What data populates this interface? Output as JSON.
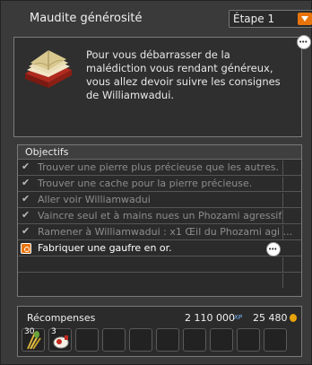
{
  "window": {
    "title": "Maudite générosité",
    "step": "Étape 1"
  },
  "description": {
    "text": "Pour vous débarrasser de la malédiction vous rendant généreux, vous allez devoir suivre les consignes de Williamwadui.",
    "icon": "book-icon"
  },
  "objectives": {
    "header": "Objectifs",
    "items": [
      {
        "label": "Trouver une pierre plus précieuse que les autres.",
        "done": true
      },
      {
        "label": "Trouver une cache pour la pierre précieuse.",
        "done": true
      },
      {
        "label": "Aller voir Williamwadui",
        "done": true
      },
      {
        "label": "Vaincre seul et à mains nues un Phozami agressif.",
        "done": true
      },
      {
        "label": "Ramener à Williamwadui : x1 Œil du Phozami agi ...",
        "done": true
      },
      {
        "label": "Fabriquer une gaufre en or.",
        "done": false
      }
    ]
  },
  "rewards": {
    "label": "Récompenses",
    "xp": "2 110 000",
    "xp_tag": "XP",
    "kamas": "25 480",
    "items": [
      {
        "qty": "30",
        "icon": "wheat-icon"
      },
      {
        "qty": "3",
        "icon": "potion-icon"
      }
    ],
    "empty_slots": 8
  },
  "colors": {
    "accent": "#e8740b",
    "background": "#3a3a3a",
    "panel": "#2b2b2b",
    "done_text": "#8d8d8d"
  }
}
